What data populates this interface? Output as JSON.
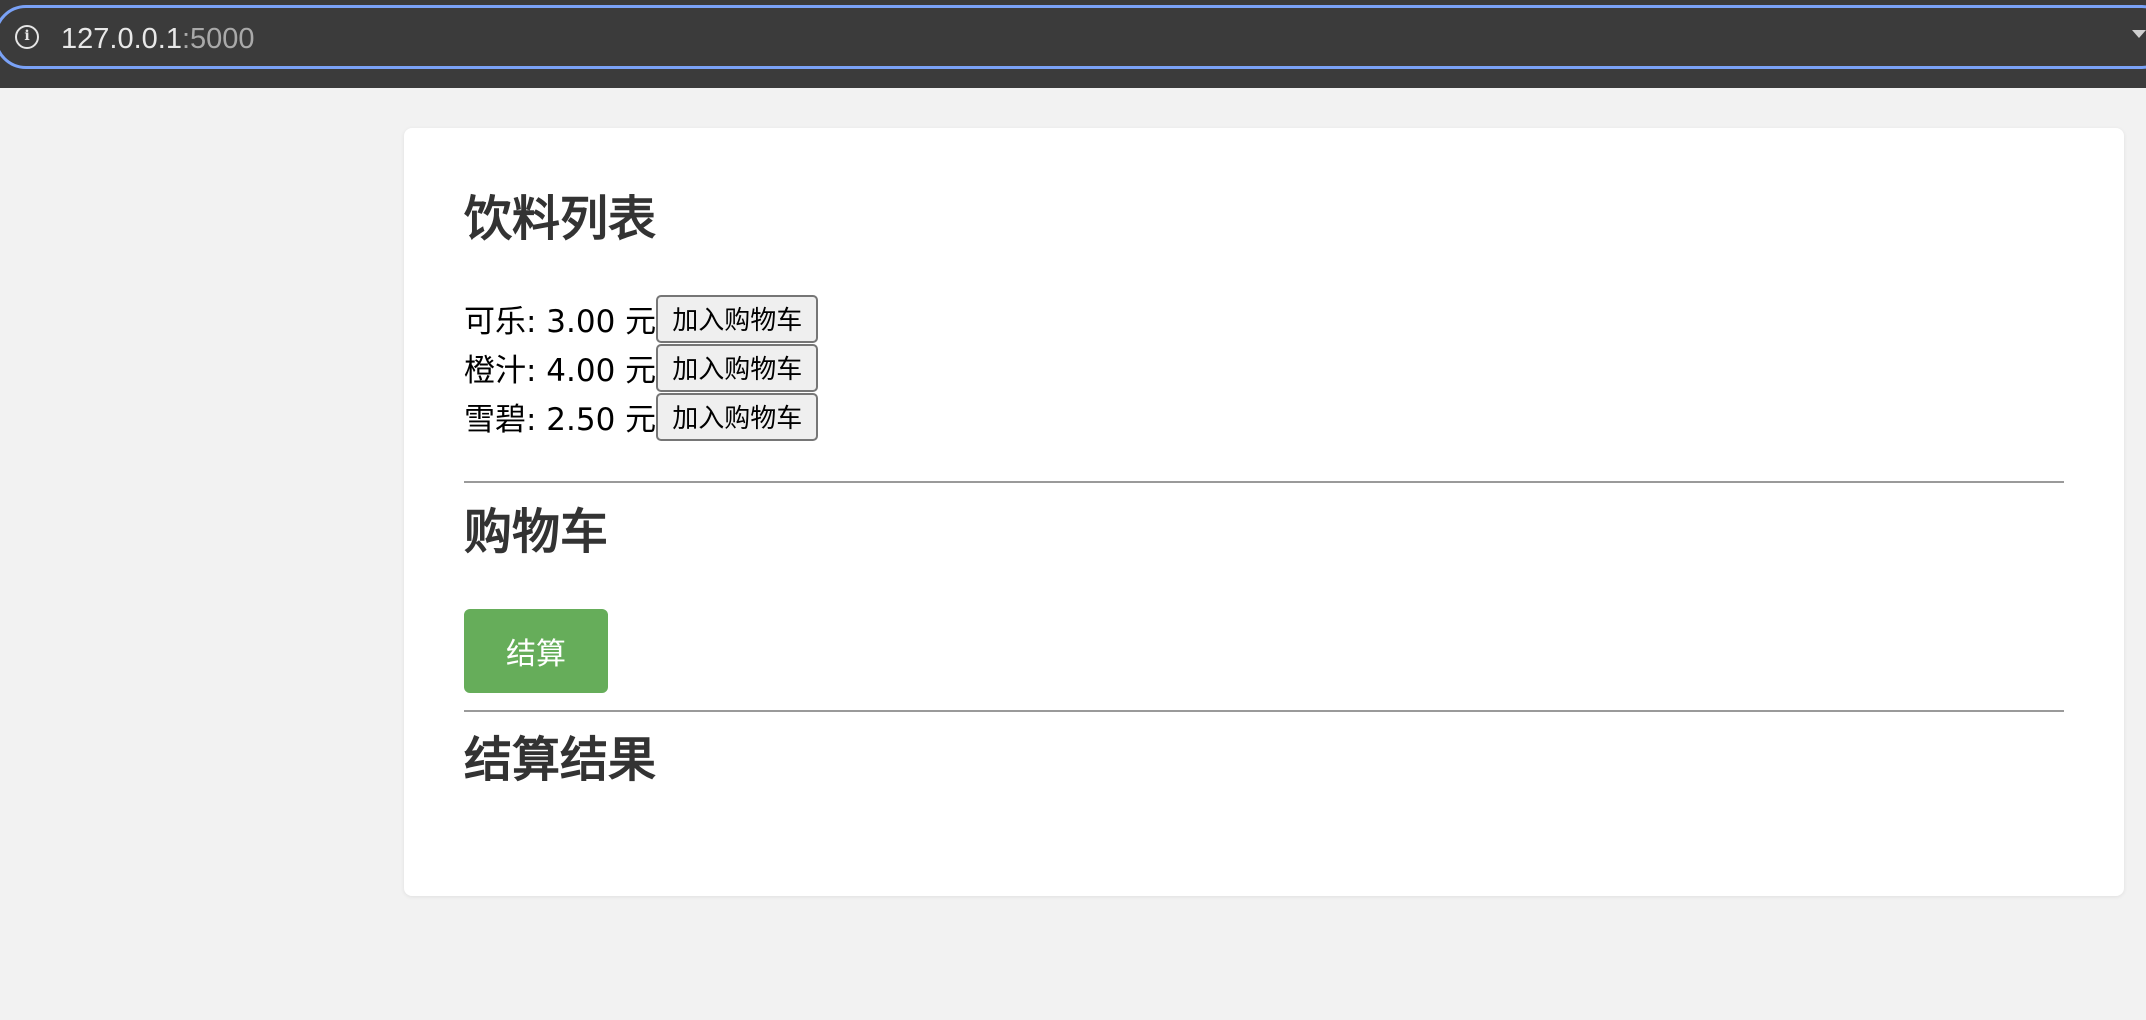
{
  "browser": {
    "url_host": "127.0.0.1",
    "url_port": ":5000",
    "info_icon": "info-icon",
    "info_glyph": "i"
  },
  "drinks": {
    "title": "饮料列表",
    "items": [
      {
        "label": "可乐: 3.00 元",
        "button": "加入购物车"
      },
      {
        "label": "橙汁: 4.00 元",
        "button": "加入购物车"
      },
      {
        "label": "雪碧: 2.50 元",
        "button": "加入购物车"
      }
    ]
  },
  "cart": {
    "title": "购物车",
    "checkout_label": "结算"
  },
  "result": {
    "title": "结算结果"
  },
  "colors": {
    "checkout_button": "#66ad5a",
    "focus_ring": "#7aa2f7"
  }
}
